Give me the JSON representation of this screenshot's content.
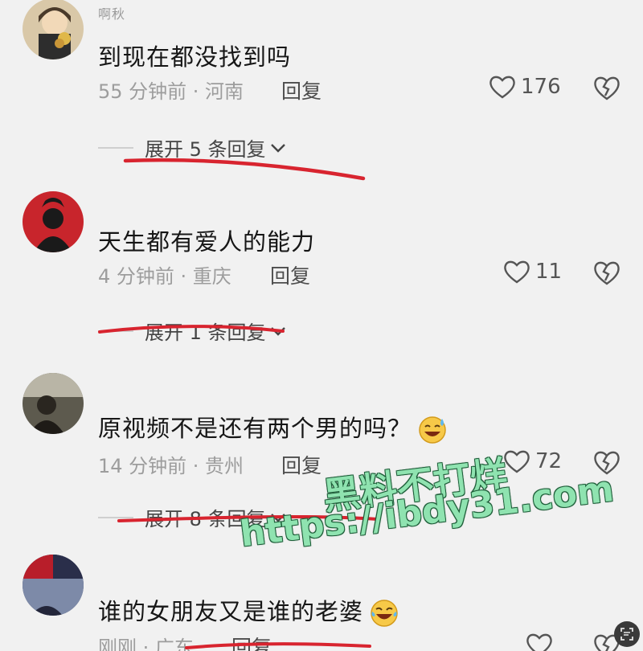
{
  "comments": [
    {
      "username": "啊秋",
      "text": "到现在都没找到吗",
      "meta": "55 分钟前 · 河南",
      "reply_label": "回复",
      "likes": "176",
      "expand_label": "展开 5 条回复"
    },
    {
      "username": "",
      "text": "天生都有爱人的能力",
      "meta": "4 分钟前 · 重庆",
      "reply_label": "回复",
      "likes": "11",
      "expand_label": "展开 1 条回复"
    },
    {
      "username": "",
      "text": "原视频不是还有两个男的吗？",
      "meta": "14 分钟前 · 贵州",
      "reply_label": "回复",
      "likes": "72",
      "expand_label": "展开 8 条回复"
    },
    {
      "username": "",
      "text": "谁的女朋友又是谁的老婆",
      "meta": "刚刚 · 广东",
      "reply_label": "回复",
      "likes": "",
      "expand_label": ""
    }
  ],
  "watermark": {
    "line1": "黑料不打烊",
    "line2": "https://ibdy31.com"
  },
  "icons": {
    "like": "heart-outline-icon",
    "dislike": "broken-heart-icon",
    "expand": "chevron-down-icon",
    "scan": "scan-icon"
  },
  "colors": {
    "annotation_red": "#d8242f",
    "watermark_green": "#8fe3b0"
  }
}
